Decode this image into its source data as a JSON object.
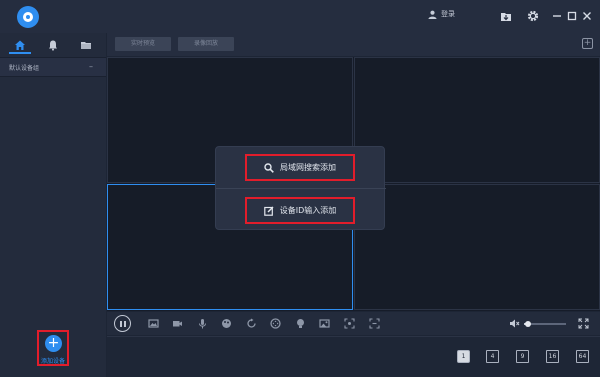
{
  "titlebar": {
    "login_label": "登录",
    "icons": [
      "app-logo",
      "user-icon",
      "download-icon",
      "gear-icon",
      "minimize-icon",
      "maximize-icon",
      "close-icon"
    ]
  },
  "sidebar": {
    "tabs": [
      "home-icon",
      "bell-icon",
      "folder-icon"
    ],
    "group_label": "默认设备组",
    "collapse_glyph": "–",
    "add_device_label": "添加设备",
    "add_glyph": "+"
  },
  "mode_tabs": {
    "live_label": "实时预览",
    "playback_label": "录像回放"
  },
  "popup": {
    "lan_search_label": "局域网搜索添加",
    "device_id_label": "设备ID输入添加"
  },
  "controls": {
    "icons": [
      "pause-icon",
      "snapshot-icon",
      "record-icon",
      "microphone-icon",
      "color-icon",
      "replay-icon",
      "ptz-icon",
      "light-icon",
      "image-icon",
      "zoom-icon",
      "fit-icon",
      "volume-icon",
      "fullscreen-icon"
    ],
    "volume_level": 0.1
  },
  "layouts": [
    "1",
    "4",
    "9",
    "16",
    "64"
  ],
  "colors": {
    "accent": "#2f8ef0",
    "highlight_border": "#e21d2b",
    "background": "#1d2535"
  }
}
